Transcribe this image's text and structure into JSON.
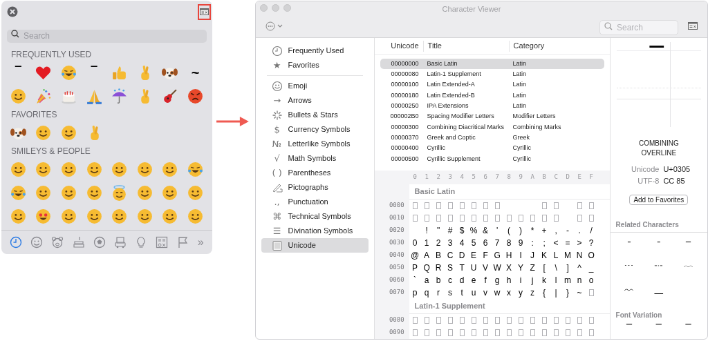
{
  "emoji_picker": {
    "search": {
      "placeholder": "Search"
    },
    "sections": [
      {
        "title": "FREQUENTLY USED",
        "items": [
          {
            "kind": "char",
            "text": "‾"
          },
          {
            "kind": "heart"
          },
          {
            "kind": "laughing-face"
          },
          {
            "kind": "char",
            "text": "‾"
          },
          {
            "kind": "thumbs-up"
          },
          {
            "kind": "hand"
          },
          {
            "kind": "dog"
          },
          {
            "kind": "char",
            "text": "~"
          },
          {
            "kind": "face"
          },
          {
            "kind": "party"
          },
          {
            "kind": "cake"
          },
          {
            "kind": "hands"
          },
          {
            "kind": "umbrella"
          },
          {
            "kind": "hand"
          },
          {
            "kind": "guitar"
          },
          {
            "kind": "angry-face"
          }
        ]
      },
      {
        "title": "FAVORITES",
        "items": [
          {
            "kind": "dog"
          },
          {
            "kind": "face"
          },
          {
            "kind": "face"
          },
          {
            "kind": "hand"
          }
        ]
      },
      {
        "title": "SMILEYS & PEOPLE",
        "items": [
          {
            "kind": "face"
          },
          {
            "kind": "face"
          },
          {
            "kind": "face"
          },
          {
            "kind": "face"
          },
          {
            "kind": "face"
          },
          {
            "kind": "face"
          },
          {
            "kind": "face"
          },
          {
            "kind": "laughing-face"
          },
          {
            "kind": "laughing-face"
          },
          {
            "kind": "face"
          },
          {
            "kind": "face"
          },
          {
            "kind": "face"
          },
          {
            "kind": "halo-face"
          },
          {
            "kind": "face"
          },
          {
            "kind": "face"
          },
          {
            "kind": "face"
          },
          {
            "kind": "face"
          },
          {
            "kind": "heart-eyes-face"
          },
          {
            "kind": "face"
          },
          {
            "kind": "face"
          },
          {
            "kind": "face"
          },
          {
            "kind": "face"
          },
          {
            "kind": "face"
          },
          {
            "kind": "face"
          }
        ]
      }
    ],
    "category_tabs": [
      {
        "kind": "clock",
        "selected": true
      },
      {
        "kind": "smiley",
        "selected": false
      },
      {
        "kind": "bear",
        "selected": false
      },
      {
        "kind": "food",
        "selected": false
      },
      {
        "kind": "ball",
        "selected": false
      },
      {
        "kind": "car",
        "selected": false
      },
      {
        "kind": "bulb",
        "selected": false
      },
      {
        "kind": "symbols",
        "selected": false
      },
      {
        "kind": "flag",
        "selected": false
      },
      {
        "kind": "more",
        "text": "»",
        "selected": false
      }
    ]
  },
  "character_viewer": {
    "window": {
      "title": "Character Viewer"
    },
    "search": {
      "placeholder": "Search"
    },
    "sidebar": {
      "groups": [
        [
          {
            "kind": "clock",
            "label": "Frequently Used",
            "selected": false
          },
          {
            "icon": "★",
            "label": "Favorites",
            "selected": false
          }
        ],
        [
          {
            "kind": "smiley",
            "label": "Emoji",
            "selected": false
          },
          {
            "icon": "→",
            "label": "Arrows",
            "selected": false
          },
          {
            "kind": "asterisk",
            "label": "Bullets & Stars",
            "selected": false
          },
          {
            "icon": "$",
            "label": "Currency Symbols",
            "selected": false
          },
          {
            "icon": "№",
            "label": "Letterlike Symbols",
            "selected": false
          },
          {
            "icon": "√",
            "label": "Math Symbols",
            "selected": false
          },
          {
            "icon": "( )",
            "label": "Parentheses",
            "selected": false
          },
          {
            "kind": "pen",
            "label": "Pictographs",
            "selected": false
          },
          {
            "icon": ".,",
            "label": "Punctuation",
            "selected": false
          },
          {
            "icon": "⌘",
            "label": "Technical Symbols",
            "selected": false
          },
          {
            "icon": "☰",
            "label": "Divination Symbols",
            "selected": false
          },
          {
            "kind": "grid",
            "label": "Unicode",
            "selected": true
          }
        ]
      ]
    },
    "table": {
      "columns": [
        "Unicode",
        "Title",
        "Category"
      ],
      "rows": [
        {
          "cells": [
            "00000000",
            "Basic Latin",
            "Latin"
          ],
          "selected": true
        },
        {
          "cells": [
            "00000080",
            "Latin-1 Supplement",
            "Latin"
          ],
          "selected": false
        },
        {
          "cells": [
            "00000100",
            "Latin Extended-A",
            "Latin"
          ],
          "selected": false
        },
        {
          "cells": [
            "00000180",
            "Latin Extended-B",
            "Latin"
          ],
          "selected": false
        },
        {
          "cells": [
            "00000250",
            "IPA Extensions",
            "Latin"
          ],
          "selected": false
        },
        {
          "cells": [
            "000002B0",
            "Spacing Modifier Letters",
            "Modifier Letters"
          ],
          "selected": false
        },
        {
          "cells": [
            "00000300",
            "Combining Diacritical Marks",
            "Combining Marks"
          ],
          "selected": false
        },
        {
          "cells": [
            "00000370",
            "Greek and Coptic",
            "Greek"
          ],
          "selected": false
        },
        {
          "cells": [
            "00000400",
            "Cyrillic",
            "Cyrillic"
          ],
          "selected": false
        },
        {
          "cells": [
            "00000500",
            "Cyrillic Supplement",
            "Cyrillic"
          ],
          "selected": false
        }
      ]
    },
    "grid": {
      "column_headers": [
        "0",
        "1",
        "2",
        "3",
        "4",
        "5",
        "6",
        "7",
        "8",
        "9",
        "A",
        "B",
        "C",
        "D",
        "E",
        "F"
      ],
      "blocks": [
        {
          "title": "Basic Latin",
          "rows": [
            {
              "label": "0000",
              "cells": [
                {
                  "kind": "missing"
                },
                {
                  "kind": "missing"
                },
                {
                  "kind": "missing"
                },
                {
                  "kind": "missing"
                },
                {
                  "kind": "missing"
                },
                {
                  "kind": "missing"
                },
                {
                  "kind": "missing"
                },
                {
                  "kind": "missing"
                },
                {
                  "kind": "blank"
                },
                {
                  "kind": "blank"
                },
                {
                  "kind": "blank"
                },
                {
                  "kind": "missing"
                },
                {
                  "kind": "missing"
                },
                {
                  "kind": "blank"
                },
                {
                  "kind": "missing"
                },
                {
                  "kind": "missing"
                }
              ]
            },
            {
              "label": "0010",
              "cells": [
                {
                  "kind": "missing"
                },
                {
                  "kind": "missing"
                },
                {
                  "kind": "missing"
                },
                {
                  "kind": "missing"
                },
                {
                  "kind": "missing"
                },
                {
                  "kind": "missing"
                },
                {
                  "kind": "missing"
                },
                {
                  "kind": "missing"
                },
                {
                  "kind": "missing"
                },
                {
                  "kind": "missing"
                },
                {
                  "kind": "missing"
                },
                {
                  "kind": "missing"
                },
                {
                  "kind": "missing"
                },
                {
                  "kind": "blank"
                },
                {
                  "kind": "missing"
                },
                {
                  "kind": "missing"
                }
              ]
            },
            {
              "label": "0020",
              "cells": [
                {
                  "kind": "blank"
                },
                "!",
                "\"",
                "#",
                "$",
                "%",
                "&",
                "'",
                "(",
                ")",
                "*",
                "+",
                ",",
                "-",
                ".",
                "/"
              ]
            },
            {
              "label": "0030",
              "cells": [
                "0",
                "1",
                "2",
                "3",
                "4",
                "5",
                "6",
                "7",
                "8",
                "9",
                ":",
                ";",
                "<",
                "=",
                ">",
                "?"
              ]
            },
            {
              "label": "0040",
              "cells": [
                "@",
                "A",
                "B",
                "C",
                "D",
                "E",
                "F",
                "G",
                "H",
                "I",
                "J",
                "K",
                "L",
                "M",
                "N",
                "O"
              ]
            },
            {
              "label": "0050",
              "cells": [
                "P",
                "Q",
                "R",
                "S",
                "T",
                "U",
                "V",
                "W",
                "X",
                "Y",
                "Z",
                "[",
                "\\",
                "]",
                "^",
                "_"
              ]
            },
            {
              "label": "0060",
              "cells": [
                "`",
                "a",
                "b",
                "c",
                "d",
                "e",
                "f",
                "g",
                "h",
                "i",
                "j",
                "k",
                "l",
                "m",
                "n",
                "o"
              ]
            },
            {
              "label": "0070",
              "cells": [
                "p",
                "q",
                "r",
                "s",
                "t",
                "u",
                "v",
                "w",
                "x",
                "y",
                "z",
                "{",
                "|",
                "}",
                "~",
                {
                  "kind": "missing"
                }
              ]
            }
          ]
        },
        {
          "title": "Latin-1 Supplement",
          "rows": [
            {
              "label": "0080",
              "cells": [
                {
                  "kind": "missing"
                },
                {
                  "kind": "missing"
                },
                {
                  "kind": "missing"
                },
                {
                  "kind": "missing"
                },
                {
                  "kind": "missing"
                },
                {
                  "kind": "missing"
                },
                {
                  "kind": "missing"
                },
                {
                  "kind": "missing"
                },
                {
                  "kind": "missing"
                },
                {
                  "kind": "missing"
                },
                {
                  "kind": "missing"
                },
                {
                  "kind": "missing"
                },
                {
                  "kind": "missing"
                },
                {
                  "kind": "missing"
                },
                {
                  "kind": "missing"
                },
                {
                  "kind": "missing"
                }
              ]
            },
            {
              "label": "0090",
              "cells": [
                {
                  "kind": "missing"
                },
                {
                  "kind": "missing"
                },
                {
                  "kind": "missing"
                },
                {
                  "kind": "missing"
                },
                {
                  "kind": "missing"
                },
                {
                  "kind": "missing"
                },
                {
                  "kind": "missing"
                },
                {
                  "kind": "missing"
                },
                {
                  "kind": "missing"
                },
                {
                  "kind": "missing"
                },
                {
                  "kind": "missing"
                },
                {
                  "kind": "missing"
                },
                {
                  "kind": "missing"
                },
                {
                  "kind": "missing"
                },
                {
                  "kind": "missing"
                },
                {
                  "kind": "missing"
                }
              ]
            }
          ]
        }
      ]
    },
    "inspector": {
      "preview": "‾",
      "name": "COMBINING OVERLINE",
      "properties": [
        {
          "label": "Unicode",
          "value": "U+0305"
        },
        {
          "label": "UTF-8",
          "value": "CC 85"
        }
      ],
      "button": "Add to Favorites",
      "related_title": "Related Characters",
      "related": [
        "¯",
        "ˉ",
        "‾",
        "﹉",
        "﹊",
        "﹋",
        "﹌",
        "—"
      ],
      "variation_title": "Font Variation",
      "variations": [
        "‾",
        "‾",
        "‾"
      ]
    }
  }
}
